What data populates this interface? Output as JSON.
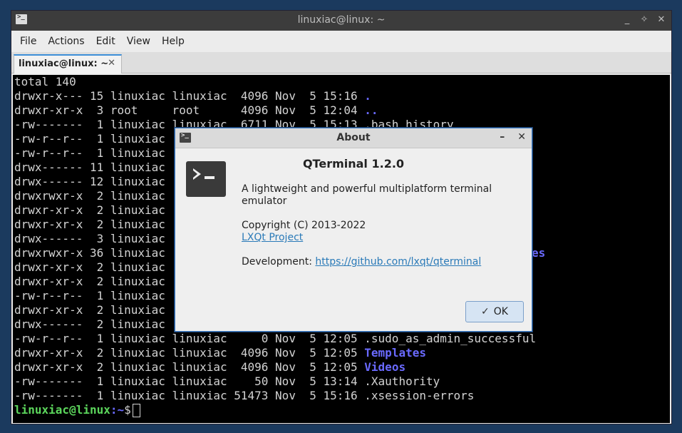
{
  "window": {
    "title": "linuxiac@linux: ~"
  },
  "menu": [
    "File",
    "Actions",
    "Edit",
    "View",
    "Help"
  ],
  "tab": {
    "label": "linuxiac@linux: ~"
  },
  "terminal": {
    "lines": [
      {
        "text": "total 140",
        "name": ""
      },
      {
        "text": "drwxr-x--- 15 linuxiac linuxiac  4096 Nov  5 15:16 ",
        "name": "."
      },
      {
        "text": "drwxr-xr-x  3 root     root      4096 Nov  5 12:04 ",
        "name": ".."
      },
      {
        "text": "-rw-------  1 linuxiac linuxiac  6711 Nov  5 15:13 .bash_history",
        "name": ""
      },
      {
        "text": "-rw-r--r--  1 linuxiac",
        "name": ""
      },
      {
        "text": "-rw-r--r--  1 linuxiac",
        "name": ""
      },
      {
        "text": "drwx------ 11 linuxiac",
        "name": ""
      },
      {
        "text": "drwx------ 12 linuxiac",
        "name": ""
      },
      {
        "text": "drwxrwxr-x  2 linuxiac",
        "name": ""
      },
      {
        "text": "drwxr-xr-x  2 linuxiac",
        "name": ""
      },
      {
        "text": "drwxr-xr-x  2 linuxiac",
        "name": ""
      },
      {
        "text": "drwx------  3 linuxiac",
        "name": ""
      },
      {
        "text": "drwxrwxr-x 36 linuxiac",
        "name": ""
      },
      {
        "text": "drwxr-xr-x  2 linuxiac",
        "name": ""
      },
      {
        "text": "drwxr-xr-x  2 linuxiac",
        "name": ""
      },
      {
        "text": "-rw-r--r--  1 linuxiac",
        "name": ""
      },
      {
        "text": "drwxr-xr-x  2 linuxiac",
        "name": ""
      },
      {
        "text": "drwx------  2 linuxiac",
        "name": ""
      },
      {
        "text": "-rw-r--r--  1 linuxiac linuxiac     0 Nov  5 12:05 .sudo_as_admin_successful",
        "name": ""
      },
      {
        "text": "drwxr-xr-x  2 linuxiac linuxiac  4096 Nov  5 12:05 ",
        "name": "Templates"
      },
      {
        "text": "drwxr-xr-x  2 linuxiac linuxiac  4096 Nov  5 12:05 ",
        "name": "Videos"
      },
      {
        "text": "-rw-------  1 linuxiac linuxiac    50 Nov  5 13:14 .Xauthority",
        "name": ""
      },
      {
        "text": "-rw-------  1 linuxiac linuxiac 51473 Nov  5 15:16 .xsession-errors",
        "name": ""
      }
    ],
    "hidden_fragment": "es",
    "prompt_user": "linuxiac@linux",
    "prompt_path": ":~",
    "prompt_symbol": "$"
  },
  "about": {
    "title": "About",
    "heading": "QTerminal 1.2.0",
    "description": "A lightweight and powerful multiplatform terminal emulator",
    "copyright": "Copyright (C) 2013-2022",
    "project_link": "LXQt Project",
    "dev_label": "Development: ",
    "dev_link": "https://github.com/lxqt/qterminal",
    "ok_label": "OK"
  },
  "icons": {
    "app": "terminal-icon",
    "minimize": "minimize-icon",
    "maximize": "maximize-icon",
    "close": "close-icon",
    "ok": "check-icon"
  },
  "colors": {
    "terminal_bg": "#000000",
    "terminal_fg": "#d3d3d3",
    "directory": "#6a6aff",
    "prompt_user": "#5cd65c",
    "accent": "#3e8fd8",
    "link": "#2a7ab8"
  }
}
